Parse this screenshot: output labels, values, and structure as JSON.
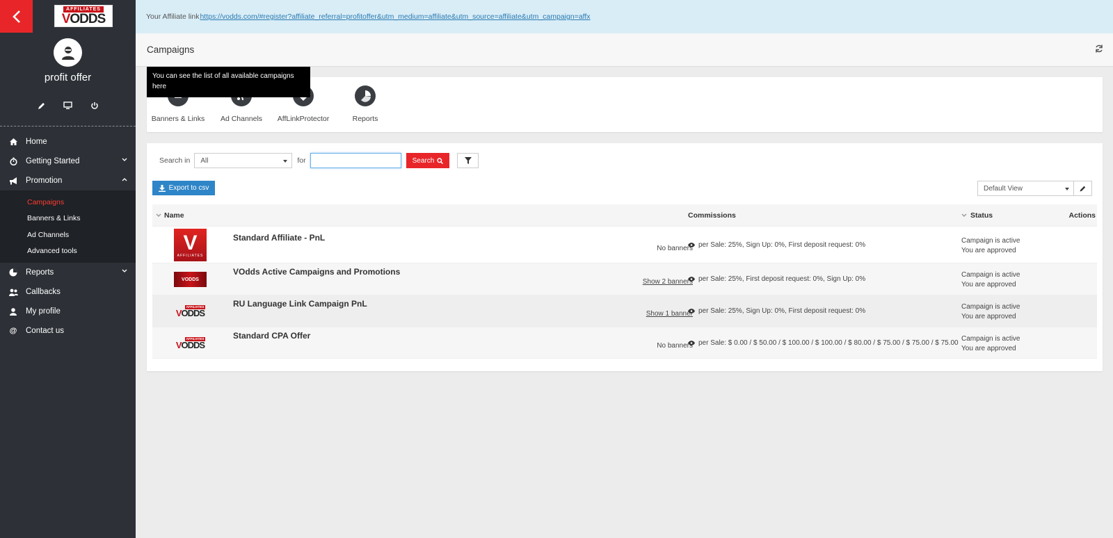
{
  "logo": {
    "top": "AFFILIATES",
    "main_v": "V",
    "main_rest": "ODDS"
  },
  "user": {
    "name": "profit offer"
  },
  "nav": {
    "home": "Home",
    "getting_started": "Getting Started",
    "promotion": "Promotion",
    "promotion_sub": [
      "Campaigns",
      "Banners & Links",
      "Ad Channels",
      "Advanced tools"
    ],
    "reports": "Reports",
    "callbacks": "Callbacks",
    "my_profile": "My profile",
    "contact_us": "Contact us"
  },
  "topbar": {
    "label": "Your Affiliate link",
    "link": "https://vodds.com/#register?affiliate_referral=profitoffer&utm_medium=affiliate&utm_source=affiliate&utm_campaign=affx"
  },
  "header": {
    "title": "Campaigns"
  },
  "tooltip": {
    "text": "You can see the list of all available campaigns here"
  },
  "tiles": [
    "Banners & Links",
    "Ad Channels",
    "AffLinkProtector",
    "Reports"
  ],
  "search": {
    "label": "Search in",
    "select_value": "All",
    "for_label": "for",
    "input_value": "",
    "button": "Search"
  },
  "export": {
    "label": "Export to csv"
  },
  "view": {
    "selected": "Default View"
  },
  "table": {
    "headers": {
      "name": "Name",
      "commissions": "Commissions",
      "status": "Status",
      "actions": "Actions"
    },
    "rows": [
      {
        "name": "Standard Affiliate - PnL",
        "banners": "No banners",
        "commission": "per Sale: 25%, Sign Up: 0%, First deposit request: 0%",
        "status": "Campaign is active",
        "approval": "You are approved",
        "logo_text": "V",
        "logo_sub": "AFFILIATES"
      },
      {
        "name": "VOdds Active Campaigns and Promotions",
        "banners": "Show 2 banners",
        "commission": "per Sale: 25%, First deposit request: 0%, Sign Up: 0%",
        "status": "Campaign is active",
        "approval": "You are approved",
        "logo_text": "VODDS"
      },
      {
        "name": "RU Language Link Campaign PnL",
        "banners": "Show 1 banner",
        "commission": "per Sale: 25%, Sign Up: 0%, First deposit request: 0%",
        "status": "Campaign is active",
        "approval": "You are approved",
        "logo_text": "ODDS"
      },
      {
        "name": "Standard CPA Offer",
        "banners": "No banners",
        "commission": "per Sale: $ 0.00 / $ 50.00 / $ 100.00 / $ 100.00 / $ 80.00 / $ 75.00 / $ 75.00 / $ 75.00",
        "status": "Campaign is active",
        "approval": "You are approved",
        "logo_text": "ODDS"
      }
    ]
  },
  "colors": {
    "accent": "#e8262a",
    "sidebar": "#2d3137",
    "primary": "#2e85c7",
    "info_bg": "#d9edf7"
  }
}
